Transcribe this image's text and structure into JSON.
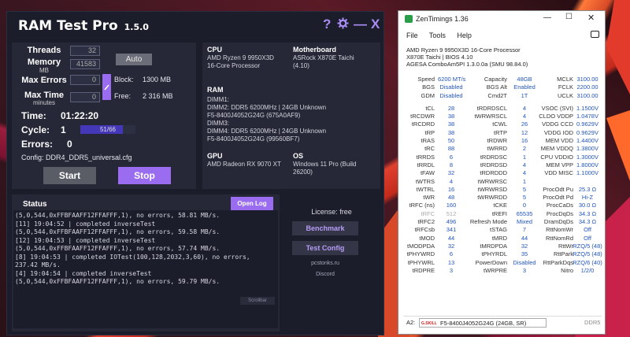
{
  "rtp": {
    "title": "RAM Test Pro",
    "version": "1.5.0",
    "help_glyph": "?",
    "settings_icon": "gear-icon",
    "minimize_glyph": "—",
    "close_glyph": "X",
    "labels": {
      "threads": "Threads",
      "memory": "Memory",
      "memory_unit": "MB",
      "max_errors": "Max Errors",
      "max_time": "Max Time",
      "max_time_unit": "minutes",
      "block": "Block:",
      "free": "Free:"
    },
    "values": {
      "threads": "32",
      "memory": "41583",
      "max_errors": "0",
      "max_time": "0",
      "block": "1300 MB",
      "free": "2 316 MB"
    },
    "auto_label": "Auto",
    "time_label": "Time:",
    "time_value": "01:22:20",
    "cycle_label": "Cycle:",
    "cycle_value": "1",
    "progress_text": "51/66",
    "progress_fraction": 0.773,
    "errors_label": "Errors:",
    "errors_value": "0",
    "config_text": "Config: DDR4_DDR5_universal.cfg",
    "start_label": "Start",
    "stop_label": "Stop",
    "sys": {
      "cpu_h": "CPU",
      "cpu_v": "AMD Ryzen 9 9950X3D\n16-Core Processor",
      "mb_h": "Motherboard",
      "mb_v": "ASRock X870E Taichi\n(4.10)",
      "ram_h": "RAM",
      "ram_v": "DIMM1:\nDIMM2: DDR5 6200MHz | 24GB Unknown\nF5-8400J4052G24G (675A0AF9)\nDIMM3:\nDIMM4: DDR5 6200MHz | 24GB Unknown\nF5-8400J4052G24G (99560BF7)",
      "gpu_h": "GPU",
      "gpu_v": "AMD Radeon RX 9070 XT",
      "os_h": "OS",
      "os_v": "Windows 11 Pro (Build\n26200)"
    },
    "status_title": "Status",
    "open_log": "Open Log",
    "log": [
      "(5,0,544,0xFFBFAAFF12FFAFFF,1), no errors, 58.81 MB/s.",
      "[11] 19:04:52 | completed inverseTest",
      "(5,0,544,0xFFBFAAFF12FFAFFF,1), no errors, 59.58 MB/s.",
      "[12] 19:04:53 | completed inverseTest",
      "(5,0,544,0xFFBFAAFF12FFAFFF,1), no errors, 57.74 MB/s.",
      "[8] 19:04:53 | completed IOTest(100,128,2032,3,60), no errors,",
      "237.42 MB/s.",
      "[4] 19:04:54 | completed inverseTest",
      "(5,0,544,0xFFBFAAFF12FFAFFF,1), no errors, 59.79 MB/s."
    ],
    "license": "License: free",
    "benchmark": "Benchmark",
    "test_config": "Test Config",
    "site": "pcstonks.ru",
    "discord": "Discord",
    "scrollbar": "Scrollbar"
  },
  "zt": {
    "title": "ZenTimings 1.36",
    "menu": [
      "File",
      "Tools",
      "Help"
    ],
    "info": [
      "AMD Ryzen 9 9950X3D 16-Core Processor",
      "X870E Taichi | BIOS 4.10",
      "AGESA ComboAm5PI 1.3.0.0a (SMU 98.84.0)"
    ],
    "rows": [
      [
        "Speed",
        "6200 MT/s",
        "Capacity",
        "48GB",
        "MCLK",
        "3100.00"
      ],
      [
        "BGS",
        "Disabled",
        "BGS Alt",
        "Enabled",
        "FCLK",
        "2200.00"
      ],
      [
        "GDM",
        "Disabled",
        "Cmd2T",
        "1T",
        "UCLK",
        "3100.00"
      ],
      [
        "tCL",
        "28",
        "tRDRDSCL",
        "4",
        "VSOC (SVI)",
        "1.1500V"
      ],
      [
        "tRCDWR",
        "38",
        "tWRWRSCL",
        "4",
        "CLDO VDDP",
        "1.0478V"
      ],
      [
        "tRCDRD",
        "38",
        "tCWL",
        "26",
        "VDDG CCD",
        "0.9629V"
      ],
      [
        "tRP",
        "38",
        "tRTP",
        "12",
        "VDDG IOD",
        "0.9629V"
      ],
      [
        "tRAS",
        "50",
        "tRDWR",
        "16",
        "MEM VDD",
        "1.4400V"
      ],
      [
        "tRC",
        "88",
        "tWRRD",
        "2",
        "MEM VDDQ",
        "1.3800V"
      ],
      [
        "tRRDS",
        "6",
        "tRDRDSC",
        "1",
        "CPU VDDIO",
        "1.3000V"
      ],
      [
        "tRRDL",
        "8",
        "tRDRDSD",
        "4",
        "MEM VPP",
        "1.8000V"
      ],
      [
        "tFAW",
        "32",
        "tRDRDDD",
        "4",
        "VDD MISC",
        "1.1000V"
      ],
      [
        "tWTRS",
        "4",
        "tWRWRSC",
        "1",
        "",
        ""
      ],
      [
        "tWTRL",
        "16",
        "tWRWRSD",
        "5",
        "ProcOdt Pu",
        "25.3 Ω"
      ],
      [
        "tWR",
        "48",
        "tWRWRDD",
        "5",
        "ProcOdt Pd",
        "Hi-Z"
      ],
      [
        "tRFC (ns)",
        "160",
        "tCKE",
        "0",
        "ProcCaDs",
        "30.0 Ω"
      ],
      [
        "tRFC",
        "512",
        "tREFI",
        "65535",
        "ProcDqDs",
        "34.3 Ω"
      ],
      [
        "tRFC2",
        "496",
        "Refresh Mode",
        "Mixed",
        "DramDqDs",
        "34.3 Ω"
      ],
      [
        "tRFCsb",
        "341",
        "tSTAG",
        "7",
        "RttNomWr",
        "Off"
      ],
      [
        "tMOD",
        "44",
        "tMRD",
        "44",
        "RttNomRd",
        "Off"
      ],
      [
        "tMODPDA",
        "32",
        "tMRDPDA",
        "32",
        "RttWr",
        "RZQ/5 (48)"
      ],
      [
        "tPHYWRD",
        "6",
        "tPHYRDL",
        "35",
        "RttPark",
        "RZQ/5 (48)"
      ],
      [
        "tPHYWRL",
        "13",
        "PowerDown",
        "Disabled",
        "RttParkDqs",
        "RZQ/6 (40)"
      ],
      [
        "tRDPRE",
        "3",
        "tWRPRE",
        "3",
        "Nitro",
        "1/2/0"
      ]
    ],
    "foot_slot": "A2:",
    "foot_brand": "G.SKILL",
    "foot_module": "F5-8400J4052G24G (24GB, SR)",
    "foot_type": "DDR5"
  }
}
